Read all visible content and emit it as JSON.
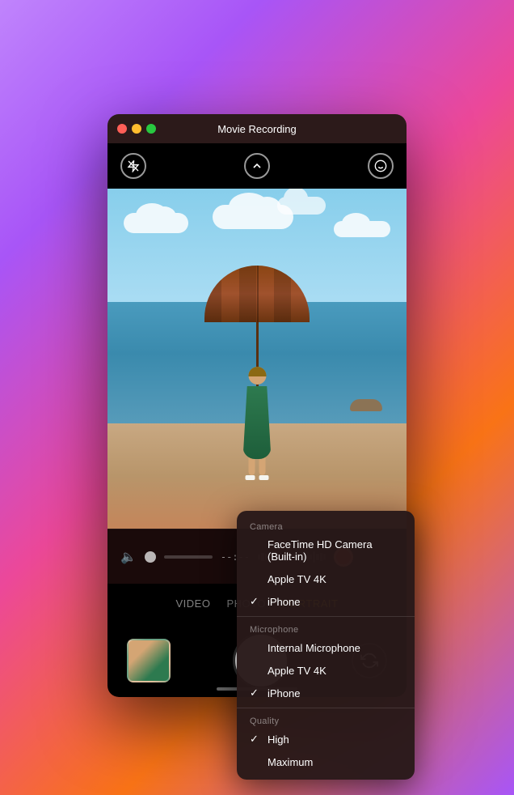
{
  "window": {
    "title": "Movie Recording",
    "trafficLights": {
      "close": "close",
      "minimize": "minimize",
      "maximize": "maximize"
    }
  },
  "topBar": {
    "flashIcon": "⚡",
    "chevronIcon": "^",
    "faceIcon": "f"
  },
  "controls": {
    "timeDisplay": "--:--",
    "recordButton": "record"
  },
  "modes": [
    {
      "label": "VIDEO",
      "active": false
    },
    {
      "label": "PHOTO",
      "active": false
    },
    {
      "label": "PORTRAIT",
      "active": true
    }
  ],
  "dropdown": {
    "camera": {
      "header": "Camera",
      "items": [
        {
          "label": "FaceTime HD Camera (Built-in)",
          "checked": false
        },
        {
          "label": "Apple TV 4K",
          "checked": false
        },
        {
          "label": "iPhone",
          "checked": true
        }
      ]
    },
    "microphone": {
      "header": "Microphone",
      "items": [
        {
          "label": "Internal Microphone",
          "checked": false
        },
        {
          "label": "Apple TV 4K",
          "checked": false
        },
        {
          "label": "iPhone",
          "checked": true
        }
      ]
    },
    "quality": {
      "header": "Quality",
      "items": [
        {
          "label": "High",
          "checked": true
        },
        {
          "label": "Maximum",
          "checked": false
        }
      ]
    }
  }
}
